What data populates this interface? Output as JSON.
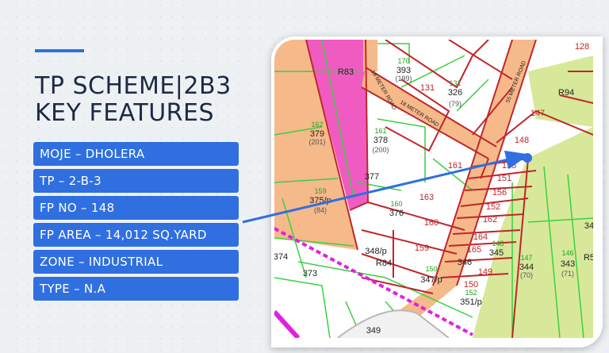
{
  "title": {
    "line1": "TP SCHEME|2B3",
    "line2": "KEY FEATURES"
  },
  "features": [
    "MOJE – DHOLERA",
    "TP – 2-B-3",
    "FP NO – 148",
    "FP AREA – 14,012 SQ.YARD",
    "ZONE – INDUSTRIAL",
    "TYPE – N.A"
  ],
  "colors": {
    "accent": "#2f6fe0",
    "title": "#1d2a44",
    "residential_zone": "#f6b98a",
    "commercial_zone": "#f05bc2",
    "industrial_zone": "#d7e89a",
    "plot_border": "#c0262b",
    "green_lines": "#39d141",
    "road": "#f6b98a"
  },
  "map": {
    "labels": [
      {
        "text": "128",
        "kind": "red"
      },
      {
        "text": "R83",
        "kind": "dark"
      },
      {
        "text": "170",
        "kind": "green"
      },
      {
        "text": "393",
        "kind": "dark"
      },
      {
        "text": "(199)",
        "kind": "gray"
      },
      {
        "text": "131",
        "kind": "red"
      },
      {
        "text": "131",
        "kind": "green"
      },
      {
        "text": "326",
        "kind": "dark"
      },
      {
        "text": "(79)",
        "kind": "gray"
      },
      {
        "text": "R94",
        "kind": "dark"
      },
      {
        "text": "147",
        "kind": "red"
      },
      {
        "text": "162",
        "kind": "green"
      },
      {
        "text": "379",
        "kind": "dark"
      },
      {
        "text": "(201)",
        "kind": "gray"
      },
      {
        "text": "161",
        "kind": "green"
      },
      {
        "text": "378",
        "kind": "dark"
      },
      {
        "text": "(200)",
        "kind": "gray"
      },
      {
        "text": "148",
        "kind": "red"
      },
      {
        "text": "161",
        "kind": "red"
      },
      {
        "text": "155",
        "kind": "red"
      },
      {
        "text": "151",
        "kind": "red"
      },
      {
        "text": "156",
        "kind": "red"
      },
      {
        "text": "152",
        "kind": "red"
      },
      {
        "text": "159",
        "kind": "green"
      },
      {
        "text": "375/p",
        "kind": "dark"
      },
      {
        "text": "(84)",
        "kind": "gray"
      },
      {
        "text": "160",
        "kind": "green"
      },
      {
        "text": "376",
        "kind": "dark"
      },
      {
        "text": "163",
        "kind": "red"
      },
      {
        "text": "160",
        "kind": "red"
      },
      {
        "text": "162",
        "kind": "red"
      },
      {
        "text": "164",
        "kind": "red"
      },
      {
        "text": "148",
        "kind": "green"
      },
      {
        "text": "165",
        "kind": "red"
      },
      {
        "text": "345",
        "kind": "dark"
      },
      {
        "text": "146",
        "kind": "green"
      },
      {
        "text": "343",
        "kind": "dark"
      },
      {
        "text": "147",
        "kind": "green"
      },
      {
        "text": "344",
        "kind": "dark"
      },
      {
        "text": "(70)",
        "kind": "gray"
      },
      {
        "text": "(71)",
        "kind": "gray"
      },
      {
        "text": "346",
        "kind": "dark"
      },
      {
        "text": "149",
        "kind": "red"
      },
      {
        "text": "159",
        "kind": "red"
      },
      {
        "text": "R84",
        "kind": "dark"
      },
      {
        "text": "348/p",
        "kind": "dark"
      },
      {
        "text": "150",
        "kind": "green"
      },
      {
        "text": "347/p",
        "kind": "dark"
      },
      {
        "text": "150",
        "kind": "red"
      },
      {
        "text": "152",
        "kind": "green"
      },
      {
        "text": "351/p",
        "kind": "dark"
      },
      {
        "text": "373",
        "kind": "dark"
      },
      {
        "text": "349",
        "kind": "dark"
      },
      {
        "text": "374",
        "kind": "dark"
      },
      {
        "text": "34",
        "kind": "dark"
      },
      {
        "text": "R5",
        "kind": "dark"
      },
      {
        "text": "377",
        "kind": "dark"
      }
    ],
    "road_labels": [
      "18 METER ROAD",
      "18 METER ROAD",
      "55 METER ROAD"
    ],
    "pointer_target": "148"
  }
}
